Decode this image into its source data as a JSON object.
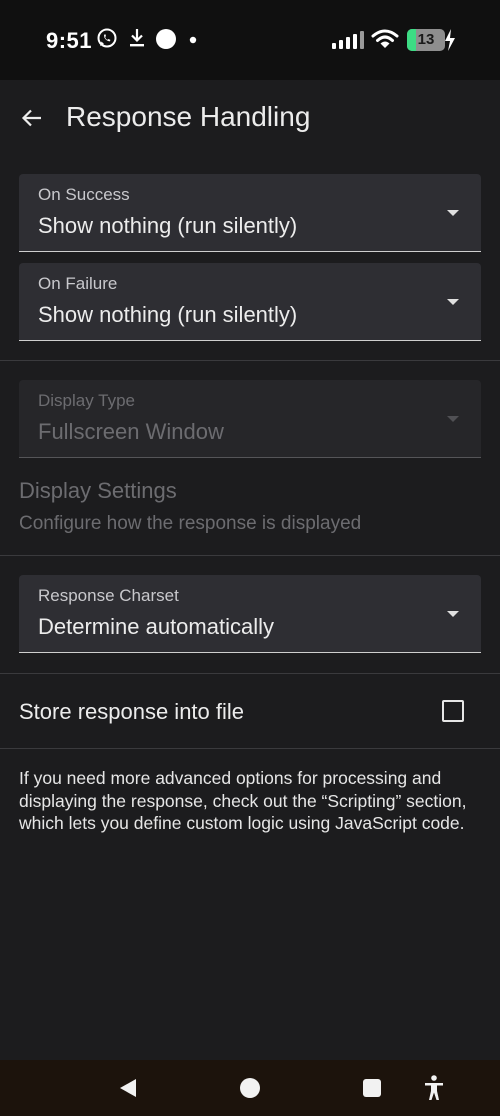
{
  "status": {
    "time": "9:51",
    "battery": "13",
    "icons": [
      "whatsapp-icon",
      "download-icon",
      "circle-notification-icon",
      "dot-icon",
      "signal-icon",
      "wifi-icon",
      "battery-icon",
      "charging-icon"
    ]
  },
  "header": {
    "title": "Response Handling",
    "back_icon": "arrow-left-icon"
  },
  "fields": {
    "on_success": {
      "label": "On Success",
      "value": "Show nothing (run silently)"
    },
    "on_failure": {
      "label": "On Failure",
      "value": "Show nothing (run silently)"
    },
    "display_type": {
      "label": "Display Type",
      "value": "Fullscreen Window",
      "enabled": false
    },
    "charset": {
      "label": "Response Charset",
      "value": "Determine automatically"
    }
  },
  "display_settings": {
    "title": "Display Settings",
    "subtitle": "Configure how the response is displayed",
    "enabled": false
  },
  "store_file": {
    "label": "Store response into file",
    "checked": false
  },
  "info": {
    "text": "If you need more advanced options for processing and displaying the response, check out the “Scripting” section, which lets you define custom logic using JavaScript code."
  },
  "nav": {
    "icons": [
      "back-triangle-icon",
      "home-circle-icon",
      "recents-square-icon",
      "accessibility-icon"
    ]
  },
  "colors": {
    "background": "#1c1c1e",
    "field_bg": "#2e2e33",
    "text": "#ececec",
    "disabled_text": "#6c6c70",
    "battery_green": "#3ddc84"
  }
}
